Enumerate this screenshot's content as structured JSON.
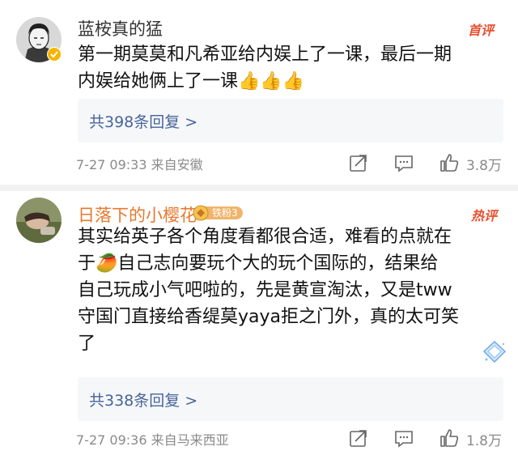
{
  "comments": [
    {
      "username": "蓝桉真的猛",
      "tag": "首评",
      "text_line1": "第一期莫莫和凡希亚给内娱上了一课，最后一期",
      "text_line2": "内娱给她俩上了一课👍👍👍",
      "replies": "共398条回复 >",
      "meta": "7-27 09:33  来自安徽",
      "likes": "3.8万"
    },
    {
      "username": "日落下的小樱花",
      "badge": "铁粉3",
      "tag": "热评",
      "text_line1": "其实给英子各个角度看都很合适，难看的点就在",
      "text_line2": "于🥭自己志向要玩个大的玩个国际的，结果给",
      "text_line3": "自己玩成小气吧啦的，先是黄宣淘汰，又是tww",
      "text_line4": "守国门直接给香缇莫yaya拒之门外，真的太可笑",
      "text_line5": "了",
      "replies": "共338条回复 >",
      "meta": "7-27 09:36  来自马来西亚",
      "likes": "1.8万"
    }
  ],
  "colors": {
    "username_special": "#e8782f",
    "tag": "#e8502f",
    "link": "#47649a",
    "meta": "#8a8a8a"
  },
  "icons": [
    "share-icon",
    "comment-icon",
    "like-icon",
    "verified-icon"
  ]
}
